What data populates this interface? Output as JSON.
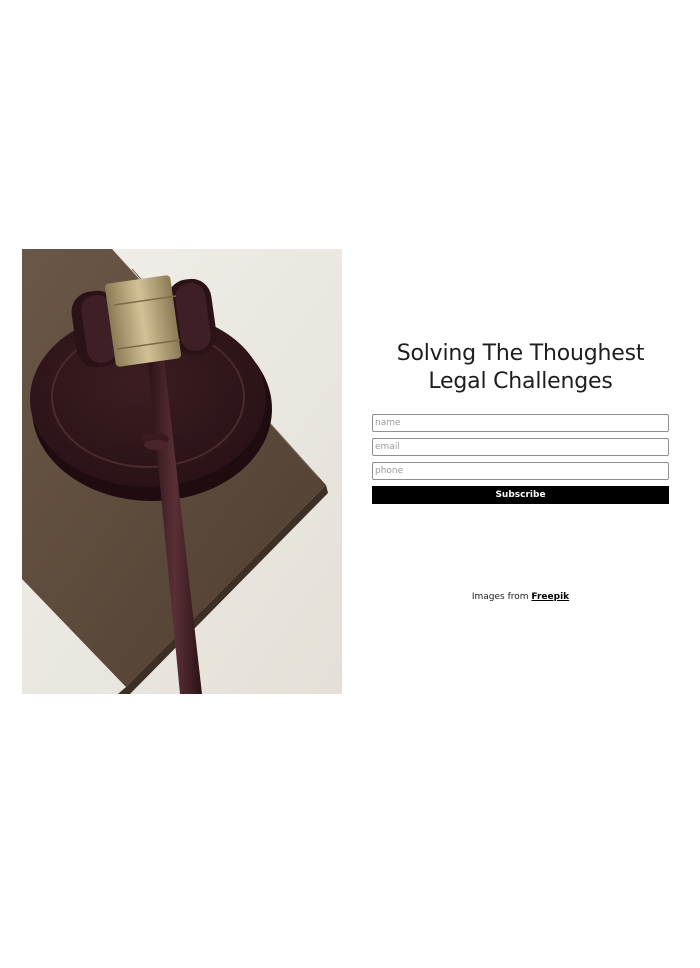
{
  "hero": {
    "image_subject": "judge-gavel-on-sound-block-and-book",
    "colors": {
      "background": "#ece9e3",
      "book": "#5c4a3c",
      "wood": "#3a1e22",
      "brass": "#b6a27a"
    }
  },
  "headline": {
    "text": "Solving The Thoughest\nLegal Challenges"
  },
  "form": {
    "name_placeholder": "name",
    "email_placeholder": "email",
    "phone_placeholder": "phone",
    "subscribe_label": "Subscribe"
  },
  "credit": {
    "prefix": "Images from",
    "link_label": "Freepik"
  }
}
